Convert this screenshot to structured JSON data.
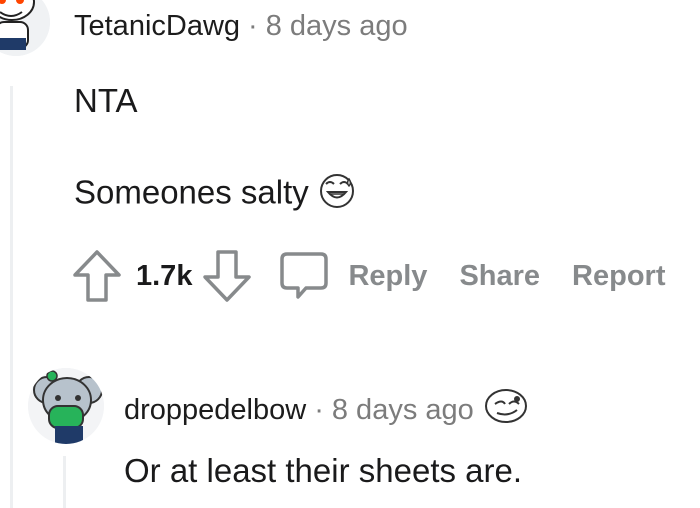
{
  "comments": [
    {
      "username": "TetanicDawg",
      "separator": "·",
      "timestamp": "8 days ago",
      "body_lines": [
        "NTA",
        "Someones salty"
      ],
      "body_emoji": "grinning-sweat-emoji",
      "score": "1.7k",
      "actions": {
        "reply": "Reply",
        "share": "Share",
        "report": "Report"
      }
    },
    {
      "username": "droppedelbow",
      "separator": "·",
      "timestamp": "8 days ago",
      "header_emoji": "smirk-emoji",
      "body_lines": [
        "Or at least their sheets are."
      ]
    }
  ],
  "icons": {
    "upvote": "upvote-arrow-icon",
    "downvote": "downvote-arrow-icon",
    "comment": "speech-bubble-icon"
  },
  "colors": {
    "text": "#1a1a1b",
    "meta": "#7c7c7c",
    "action": "#878a8c",
    "thread_line": "#edeff1"
  }
}
